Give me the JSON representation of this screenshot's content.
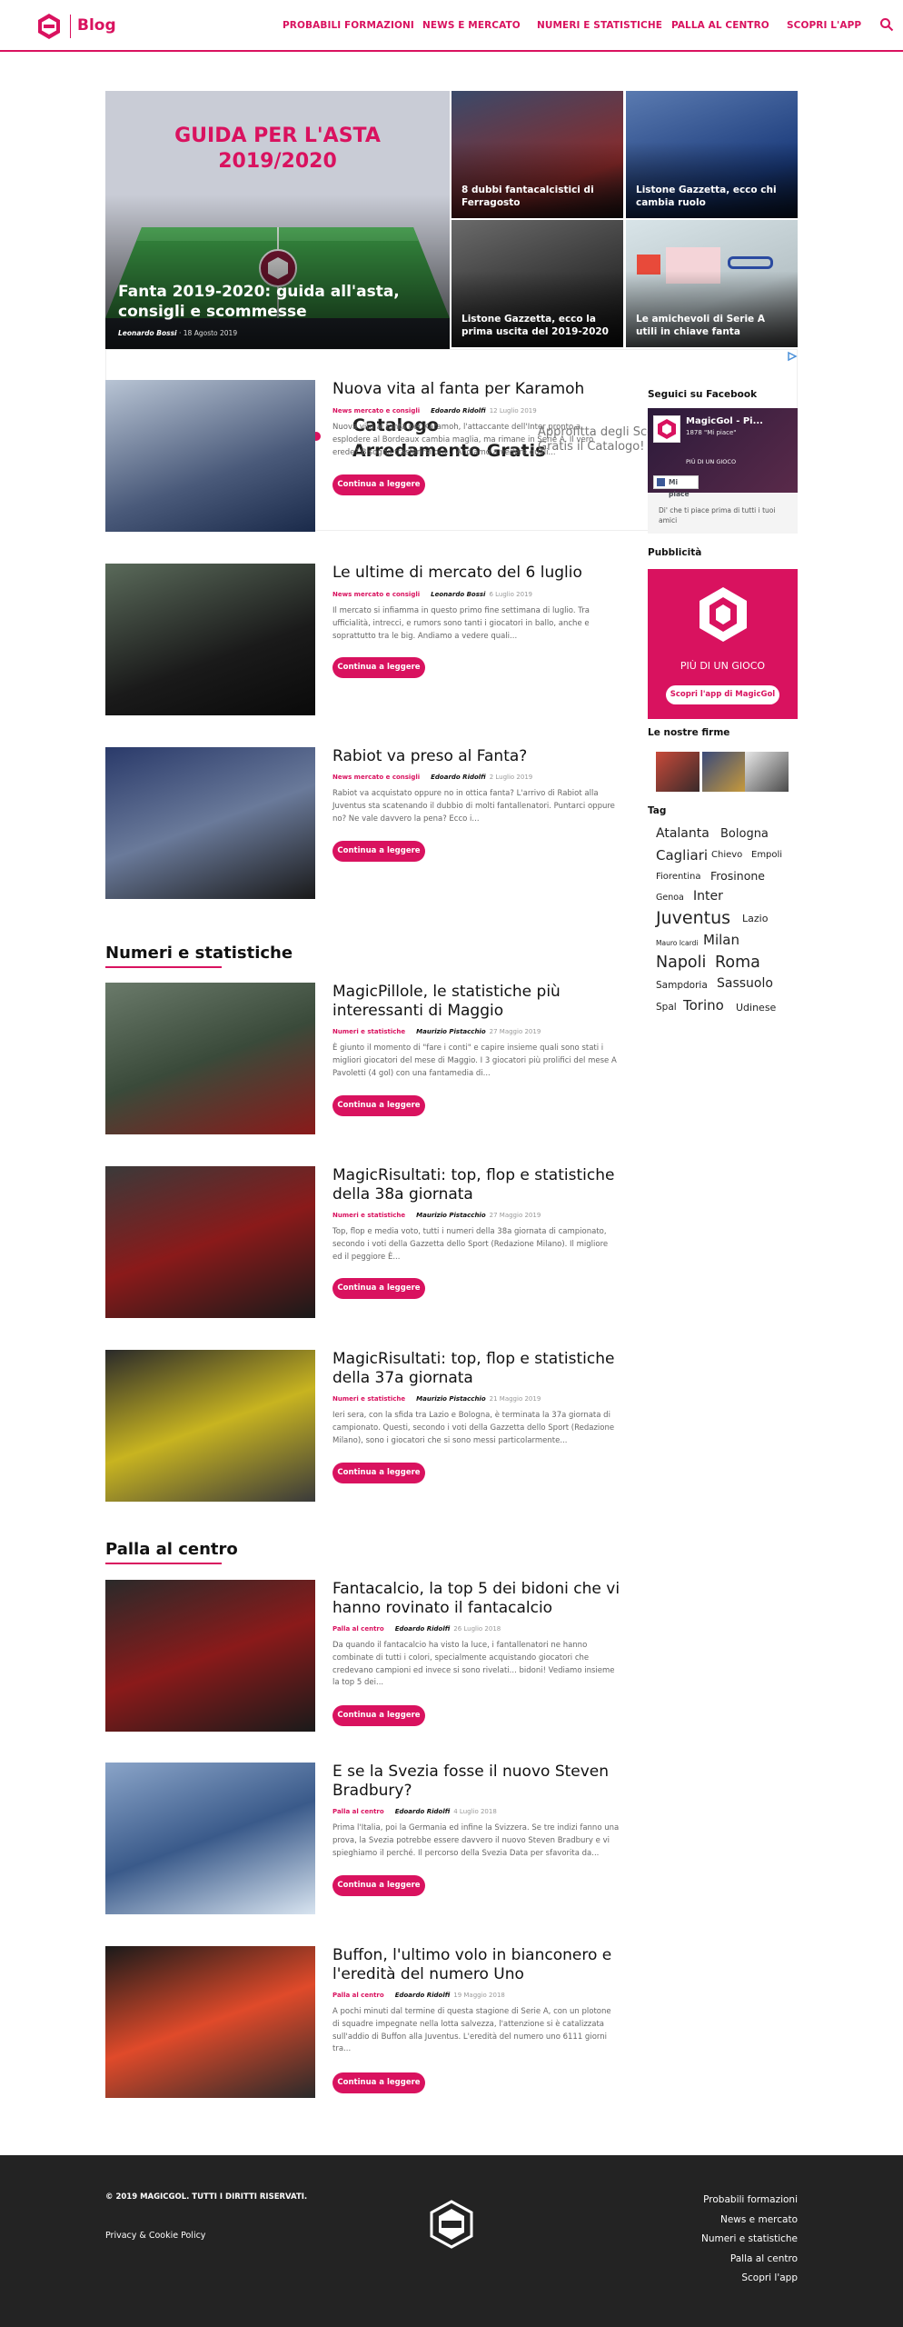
{
  "brand": {
    "logo_text": "MAGIC GOL",
    "blog_label": "Blog",
    "accent": "#d9125f"
  },
  "nav": {
    "items": [
      "PROBABILI FORMAZIONI",
      "NEWS E MERCATO",
      "NUMERI E STATISTICHE",
      "PALLA AL CENTRO",
      "SCOPRI L'APP"
    ]
  },
  "hero": {
    "main": {
      "banner_line1": "GUIDA PER L'ASTA",
      "banner_line2": "2019/2020",
      "title": "Fanta 2019-2020: guida all'asta, consigli e scommesse",
      "author": "Leonardo Bossi",
      "date": "18 Agosto 2019"
    },
    "tiles": [
      {
        "title": "8 dubbi fantacalcistici di Ferragosto"
      },
      {
        "title": "Listone Gazzetta, ecco chi cambia ruolo"
      },
      {
        "title": "Listone Gazzetta, ecco la prima uscita del 2019-2020"
      },
      {
        "title": "Le amichevoli di Serie A utili in chiave fanta"
      }
    ]
  },
  "ad": {
    "heading1": "Catalogo",
    "heading2": "Arredamento Gratis",
    "text1": "Approfitta degli Sco",
    "text2": "Gratis il Catalogo!"
  },
  "articles": [
    {
      "title": "Nuova vita al fanta per Karamoh",
      "category": "News mercato e consigli",
      "author": "Edoardo Ridolfi",
      "date": "12 Luglio 2019",
      "excerpt": "Nuova vita al fanta per Karamoh, l'attaccante dell'Inter pronto a esplodere al Bordeaux cambia maglia, ma rimane in Serie A. Il vero erede? Bisogna trasferirsi ora... Andiamo a vedere quali...",
      "button": "Continua a leggere"
    },
    {
      "title": "Le ultime di mercato del 6 luglio",
      "category": "News mercato e consigli",
      "author": "Leonardo Bossi",
      "date": "6 Luglio 2019",
      "excerpt": "Il mercato si infiamma in questo primo fine settimana di luglio. Tra ufficialità, intrecci, e rumors sono tanti i giocatori in ballo, anche e soprattutto tra le big. Andiamo a vedere quali...",
      "button": "Continua a leggere"
    },
    {
      "title": "Rabiot va preso al Fanta?",
      "category": "News mercato e consigli",
      "author": "Edoardo Ridolfi",
      "date": "2 Luglio 2019",
      "excerpt": "Rabiot va acquistato oppure no in ottica fanta? L'arrivo di Rabiot alla Juventus sta scatenando il dubbio di molti fantallenatori. Puntarci oppure no? Ne vale davvero la pena? Ecco i...",
      "button": "Continua a leggere"
    }
  ],
  "sections": [
    {
      "title": "Numeri e statistiche",
      "articles": [
        {
          "title": "MagicPillole, le statistiche più interessanti di Maggio",
          "category": "Numeri e statistiche",
          "author": "Maurizio Pistacchio",
          "date": "27 Maggio 2019",
          "excerpt": "È giunto il momento di \"fare i conti\" e capire insieme quali sono stati i migliori giocatori del mese di Maggio. I 3 giocatori più prolifici del mese A Pavoletti (4 gol) con una fantamedia di...",
          "button": "Continua a leggere"
        },
        {
          "title": "MagicRisultati: top, flop e statistiche della 38a giornata",
          "category": "Numeri e statistiche",
          "author": "Maurizio Pistacchio",
          "date": "27 Maggio 2019",
          "excerpt": "Top, flop e media voto, tutti i numeri della 38a giornata di campionato, secondo i voti della Gazzetta dello Sport (Redazione Milano). Il migliore ed il peggiore È...",
          "button": "Continua a leggere"
        },
        {
          "title": "MagicRisultati: top, flop e statistiche della 37a giornata",
          "category": "Numeri e statistiche",
          "author": "Maurizio Pistacchio",
          "date": "21 Maggio 2019",
          "excerpt": "Ieri sera, con la sfida tra Lazio e Bologna, è terminata la 37a giornata di campionato. Questi, secondo i voti della Gazzetta dello Sport (Redazione Milano), sono i giocatori che si sono messi particolarmente...",
          "button": "Continua a leggere"
        }
      ]
    },
    {
      "title": "Palla al centro",
      "articles": [
        {
          "title": "Fantacalcio, la top 5 dei bidoni che vi hanno rovinato il fantacalcio",
          "category": "Palla al centro",
          "author": "Edoardo Ridolfi",
          "date": "26 Luglio 2018",
          "excerpt": "Da quando il fantacalcio ha visto la luce, i fantallenatori ne hanno combinate di tutti i colori, specialmente acquistando giocatori che credevano campioni ed invece si sono rivelati... bidoni! Vediamo insieme la top 5 dei...",
          "button": "Continua a leggere"
        },
        {
          "title": "E se la Svezia fosse il nuovo Steven Bradbury?",
          "category": "Palla al centro",
          "author": "Edoardo Ridolfi",
          "date": "4 Luglio 2018",
          "excerpt": "Prima l'Italia, poi la Germania ed infine la Svizzera. Se tre indizi fanno una prova, la Svezia potrebbe essere davvero il nuovo Steven Bradbury e vi spieghiamo il perché. Il percorso della Svezia Data per sfavorita da...",
          "button": "Continua a leggere"
        },
        {
          "title": "Buffon, l'ultimo volo in bianconero e l'eredità del numero Uno",
          "category": "Palla al centro",
          "author": "Edoardo Ridolfi",
          "date": "19 Maggio 2018",
          "excerpt": "A pochi minuti dal termine di questa stagione di Serie A, con un plotone di squadre impegnate nella lotta salvezza, l'attenzione si è catalizzata sull'addio di Buffon alla Juventus. L'eredità del numero uno 6111 giorni tra...",
          "button": "Continua a leggere"
        }
      ]
    }
  ],
  "sidebar": {
    "facebook": {
      "heading": "Seguici su Facebook",
      "page_name": "MagicGol - Pi...",
      "likes": "1878 \"Mi piace\"",
      "banner_text": "PIÙ DI UN GIOCO",
      "like_button": "Mi piace",
      "note": "Di' che ti piace prima di tutti i tuoi amici"
    },
    "ads": {
      "heading": "Pubblicità",
      "tagline": "PIÙ DI UN GIOCO",
      "button": "Scopri l'app di MagicGol"
    },
    "firme": {
      "heading": "Le nostre firme"
    },
    "tags": {
      "heading": "Tag",
      "items": [
        "Atalanta",
        "Bologna",
        "Cagliari",
        "Chievo",
        "Empoli",
        "Fiorentina",
        "Frosinone",
        "Genoa",
        "Inter",
        "Juventus",
        "Lazio",
        "Mauro Icardi",
        "Milan",
        "Napoli",
        "Roma",
        "Sampdoria",
        "Sassuolo",
        "Spal",
        "Torino",
        "Udinese"
      ]
    }
  },
  "footer": {
    "copyright": "© 2019 MAGICGOL. TUTTI I DIRITTI RISERVATI.",
    "privacy": "Privacy & Cookie Policy",
    "links": [
      "Probabili formazioni",
      "News e mercato",
      "Numeri e statistiche",
      "Palla al centro",
      "Scopri l'app"
    ]
  }
}
